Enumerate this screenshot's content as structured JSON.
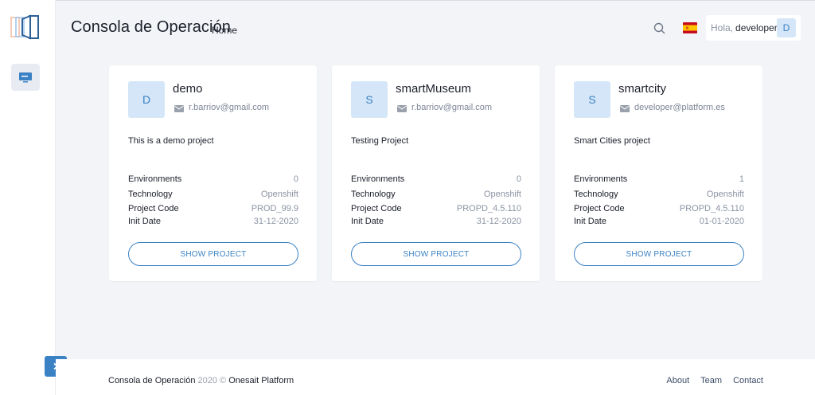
{
  "header": {
    "title": "Consola de Operación",
    "breadcrumb": "Home",
    "greeting": "Hola,",
    "username": "developer",
    "avatar_initial": "D"
  },
  "projects": [
    {
      "initial": "D",
      "name": "demo",
      "email": "r.barriov@gmail.com",
      "description": "This is a demo project",
      "details": [
        {
          "label": "Environments",
          "value": "0"
        },
        {
          "label": "Technology",
          "value": "Openshift"
        },
        {
          "label": "Project Code",
          "value": "PROD_99.9"
        },
        {
          "label": "Init Date",
          "value": "31-12-2020"
        }
      ],
      "button": "SHOW PROJECT"
    },
    {
      "initial": "S",
      "name": "smartMuseum",
      "email": "r.barriov@gmail.com",
      "description": "Testing Project",
      "details": [
        {
          "label": "Environments",
          "value": "0"
        },
        {
          "label": "Technology",
          "value": "Openshift"
        },
        {
          "label": "Project Code",
          "value": "PROPD_4.5.110"
        },
        {
          "label": "Init Date",
          "value": "31-12-2020"
        }
      ],
      "button": "SHOW PROJECT"
    },
    {
      "initial": "S",
      "name": "smartcity",
      "email": "developer@platform.es",
      "description": "Smart Cities project",
      "details": [
        {
          "label": "Environments",
          "value": "1"
        },
        {
          "label": "Technology",
          "value": "Openshift"
        },
        {
          "label": "Project Code",
          "value": "PROPD_4.5.110"
        },
        {
          "label": "Init Date",
          "value": "01-01-2020"
        }
      ],
      "button": "SHOW PROJECT"
    }
  ],
  "footer": {
    "app": "Consola de Operación",
    "year": "2020 ©",
    "brand": "Onesait Platform",
    "links": [
      "About",
      "Team",
      "Contact"
    ]
  },
  "colors": {
    "accent": "#3b82c4",
    "background": "#f2f4f7",
    "avatar_bg": "#d4e6f7"
  },
  "icons": {
    "logo": "onesait-logo",
    "sidebar": "monitor-icon",
    "search": "search-icon",
    "flag": "spain-flag-icon",
    "email": "envelope-icon",
    "expand": "chevron-right-icon"
  }
}
